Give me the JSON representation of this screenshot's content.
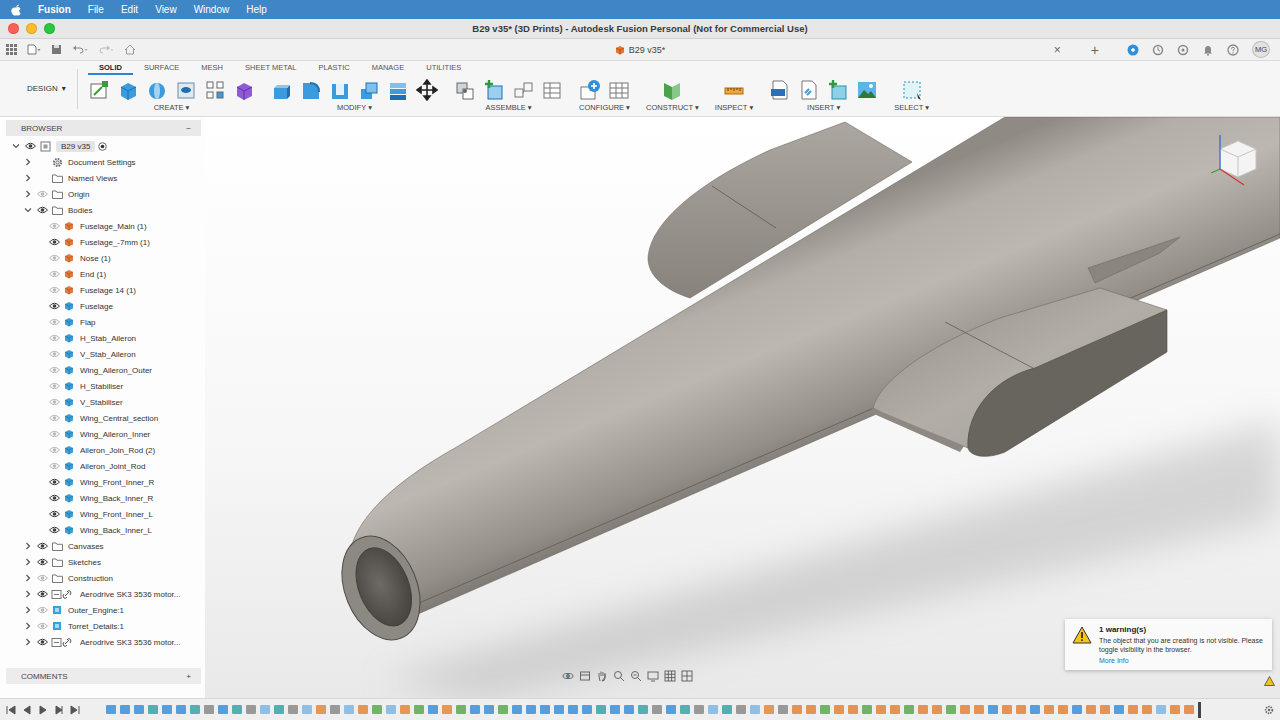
{
  "menubar": {
    "app": "Fusion",
    "items": [
      "File",
      "Edit",
      "View",
      "Window",
      "Help"
    ]
  },
  "window": {
    "title": "B29 v35* (3D Prints) - Autodesk Fusion Personal (Not for Commercial Use)"
  },
  "doc_tab": {
    "label": "B29 v35*",
    "close": "×",
    "new_tab": "+"
  },
  "user": {
    "initials": "MG"
  },
  "caret": "▾",
  "workspace": {
    "label": "DESIGN"
  },
  "toolbar_tabs": [
    {
      "label": "SOLID",
      "selected": true
    },
    {
      "label": "SURFACE",
      "selected": false
    },
    {
      "label": "MESH",
      "selected": false
    },
    {
      "label": "SHEET METAL",
      "selected": false
    },
    {
      "label": "PLASTIC",
      "selected": false
    },
    {
      "label": "MANAGE",
      "selected": false
    },
    {
      "label": "UTILITIES",
      "selected": false
    }
  ],
  "toolbar_groups": [
    "CREATE",
    "MODIFY",
    "ASSEMBLE",
    "CONFIGURE",
    "CONSTRUCT",
    "INSPECT",
    "INSERT",
    "SELECT"
  ],
  "browser": {
    "title": "BROWSER",
    "collapse": "−",
    "root": {
      "label": "B29 v35",
      "visible": true,
      "expanded": true
    },
    "items": [
      {
        "label": "Document Settings",
        "kind": "settings",
        "depth": 1,
        "expanded": false
      },
      {
        "label": "Named Views",
        "kind": "views",
        "depth": 1,
        "expanded": false
      },
      {
        "label": "Origin",
        "kind": "folder",
        "depth": 1,
        "expanded": false,
        "visible": false
      },
      {
        "label": "Bodies",
        "kind": "folder",
        "depth": 1,
        "expanded": true,
        "visible": true
      },
      {
        "label": "Fuselage_Main (1)",
        "kind": "body",
        "depth": 2,
        "visible": false,
        "color": "#e07a3c"
      },
      {
        "label": "Fuselage_-7mm (1)",
        "kind": "body",
        "depth": 2,
        "visible": true,
        "color": "#e07a3c"
      },
      {
        "label": "Nose (1)",
        "kind": "body",
        "depth": 2,
        "visible": false,
        "color": "#e07a3c"
      },
      {
        "label": "End (1)",
        "kind": "body",
        "depth": 2,
        "visible": false,
        "color": "#e07a3c"
      },
      {
        "label": "Fuselage 14 (1)",
        "kind": "body",
        "depth": 2,
        "visible": false,
        "color": "#e07a3c"
      },
      {
        "label": "Fuselage",
        "kind": "body",
        "depth": 2,
        "visible": true,
        "color": "#3d9fd9"
      },
      {
        "label": "Flap",
        "kind": "body",
        "depth": 2,
        "visible": false,
        "color": "#3d9fd9"
      },
      {
        "label": "H_Stab_Aileron",
        "kind": "body",
        "depth": 2,
        "visible": false,
        "color": "#3d9fd9"
      },
      {
        "label": "V_Stab_Aileron",
        "kind": "body",
        "depth": 2,
        "visible": false,
        "color": "#3d9fd9"
      },
      {
        "label": "Wing_Aileron_Outer",
        "kind": "body",
        "depth": 2,
        "visible": false,
        "color": "#3d9fd9"
      },
      {
        "label": "H_Stabiliser",
        "kind": "body",
        "depth": 2,
        "visible": false,
        "color": "#3d9fd9"
      },
      {
        "label": "V_Stabiliser",
        "kind": "body",
        "depth": 2,
        "visible": false,
        "color": "#3d9fd9"
      },
      {
        "label": "Wing_Central_section",
        "kind": "body",
        "depth": 2,
        "visible": false,
        "color": "#3d9fd9"
      },
      {
        "label": "Wing_Aileron_Inner",
        "kind": "body",
        "depth": 2,
        "visible": false,
        "color": "#3d9fd9"
      },
      {
        "label": "Aileron_Join_Rod (2)",
        "kind": "body",
        "depth": 2,
        "visible": false,
        "color": "#3d9fd9"
      },
      {
        "label": "Aileron_Joint_Rod",
        "kind": "body",
        "depth": 2,
        "visible": false,
        "color": "#3d9fd9"
      },
      {
        "label": "Wing_Front_Inner_R",
        "kind": "body",
        "depth": 2,
        "visible": true,
        "color": "#3d9fd9"
      },
      {
        "label": "Wing_Back_Inner_R",
        "kind": "body",
        "depth": 2,
        "visible": true,
        "color": "#3d9fd9"
      },
      {
        "label": "Wing_Front_Inner_L",
        "kind": "body",
        "depth": 2,
        "visible": true,
        "color": "#3d9fd9"
      },
      {
        "label": "Wing_Back_Inner_L",
        "kind": "body",
        "depth": 2,
        "visible": true,
        "color": "#3d9fd9"
      },
      {
        "label": "Canvases",
        "kind": "folder",
        "depth": 1,
        "expanded": false,
        "visible": true
      },
      {
        "label": "Sketches",
        "kind": "folder",
        "depth": 1,
        "expanded": false,
        "visible": true
      },
      {
        "label": "Construction",
        "kind": "folder",
        "depth": 1,
        "expanded": false,
        "visible": false
      },
      {
        "label": "Aerodrive SK3 3536 motor...",
        "kind": "link",
        "depth": 1,
        "expanded": false,
        "visible": true
      },
      {
        "label": "Outer_Engine:1",
        "kind": "component",
        "depth": 1,
        "expanded": false,
        "visible": false
      },
      {
        "label": "Torret_Details:1",
        "kind": "component",
        "depth": 1,
        "expanded": false,
        "visible": false
      },
      {
        "label": "Aerodrive SK3 3536 motor...",
        "kind": "link",
        "depth": 1,
        "expanded": false,
        "visible": true
      }
    ]
  },
  "comments": {
    "label": "COMMENTS",
    "add": "+"
  },
  "warning": {
    "title": "1 warning(s)",
    "message": "The object that you are creating is not visible. Please toggle visibility in the browser.",
    "link": "More Info"
  }
}
